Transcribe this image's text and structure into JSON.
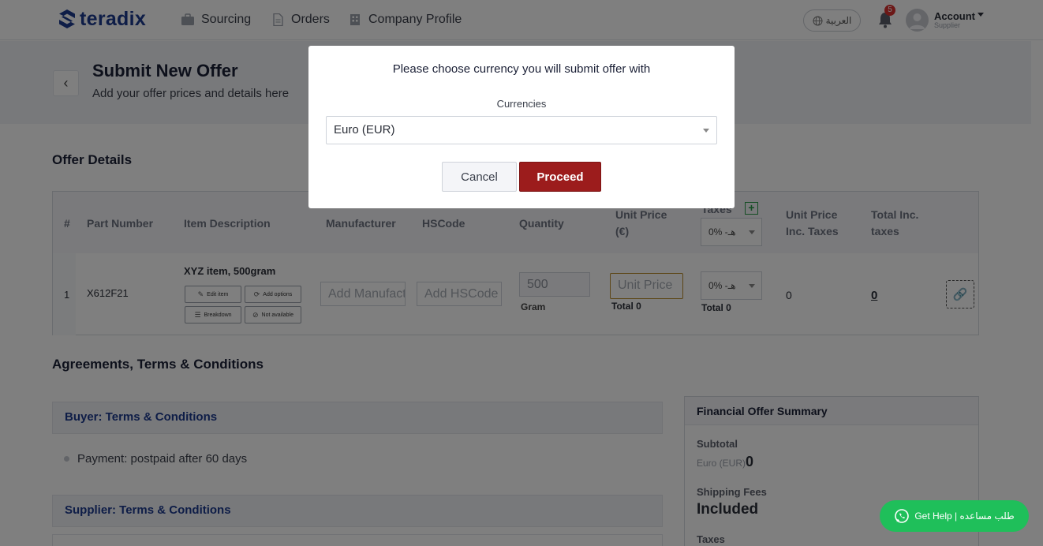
{
  "nav": {
    "logo_text": "teradix",
    "items": [
      {
        "label": "Sourcing",
        "icon": "briefcase-icon"
      },
      {
        "label": "Orders",
        "icon": "document-icon"
      },
      {
        "label": "Company Profile",
        "icon": "building-icon"
      }
    ],
    "language": "العربية",
    "notifications_count": "5",
    "account_label": "Account",
    "account_role": "Supplier"
  },
  "header": {
    "title": "Submit New Offer",
    "subtitle": "Add your offer prices and details here"
  },
  "offer_details": {
    "section_title": "Offer Details",
    "columns": [
      "#",
      "Part Number",
      "Item Description",
      "Manufacturer",
      "HSCode",
      "Quantity",
      "Unit Price",
      "(€)",
      "Taxes",
      "Unit Price",
      "Inc. Taxes",
      "Total Inc.",
      "taxes"
    ],
    "header_tax_select": "0% -هـ",
    "row": {
      "index": "1",
      "part_number": "X612F21",
      "description": "XYZ item, 500gram",
      "buttons": [
        "Edit item",
        "Add options",
        "Breakdown",
        "Not available"
      ],
      "manufacturer_placeholder": "Add Manufacturer",
      "hscode_placeholder": "Add HSCode",
      "quantity": "500",
      "unit": "Gram",
      "unit_price_placeholder": "Unit Price",
      "unit_price_total": "Total 0",
      "tax_select": "0% -هـ",
      "tax_total": "Total 0",
      "unit_price_inc_taxes": "0",
      "total_inc_taxes": "0"
    }
  },
  "agreements": {
    "section_title": "Agreements, Terms & Conditions",
    "buyer_title": "Buyer: Terms & Conditions",
    "buyer_terms": [
      "Payment: postpaid after 60 days"
    ],
    "supplier_title": "Supplier: Terms & Conditions"
  },
  "summary": {
    "title": "Financial Offer Summary",
    "subtotal_label": "Subtotal",
    "subtotal_currency": "Euro (EUR)",
    "subtotal_value": "0",
    "shipping_label": "Shipping Fees",
    "shipping_value": "Included",
    "taxes_label": "Taxes"
  },
  "help_button": "Get Help | طلب مساعده",
  "modal": {
    "title": "Please choose currency you will submit offer with",
    "field_label": "Currencies",
    "selected_currency": "Euro (EUR)",
    "cancel_label": "Cancel",
    "proceed_label": "Proceed"
  },
  "colors": {
    "brand": "#1d3a8f",
    "proceed": "#9c1c1c",
    "help": "#1fbf5a",
    "badge": "#d9302e"
  }
}
